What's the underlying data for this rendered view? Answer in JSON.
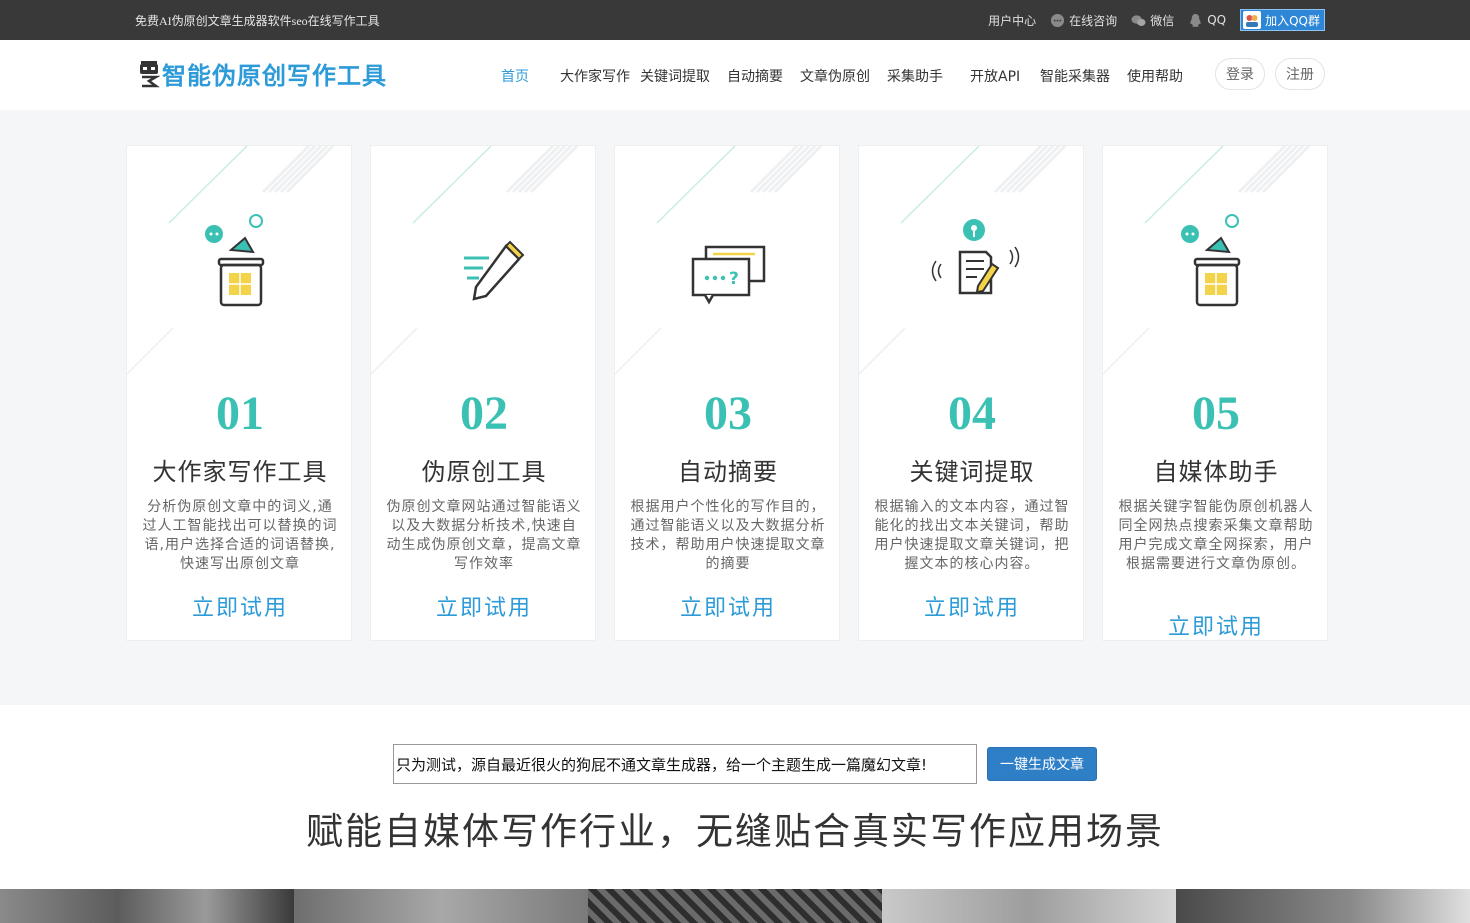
{
  "topbar": {
    "slogan": "免费AI伪原创文章生成器软件seo在线写作工具",
    "user_center": "用户中心",
    "consult": "在线咨询",
    "wechat": "微信",
    "qq": "QQ",
    "qq_group": "加入QQ群"
  },
  "header": {
    "brand": "智能伪原创写作工具",
    "nav": [
      "首页",
      "大作家写作",
      "关键词提取",
      "自动摘要",
      "文章伪原创",
      "采集助手",
      "开放API",
      "智能采集器",
      "使用帮助"
    ],
    "login": "登录",
    "register": "注册"
  },
  "features": [
    {
      "num": "01",
      "title": "大作家写作工具",
      "desc": "分析伪原创文章中的词义,通过人工智能找出可以替换的词语,用户选择合适的词语替换,快速写出原创文章",
      "cta": "立即试用",
      "icon": "jar-icon"
    },
    {
      "num": "02",
      "title": "伪原创工具",
      "desc": "伪原创文章网站通过智能语义以及大数据分析技术,快速自动生成伪原创文章，提高文章写作效率",
      "cta": "立即试用",
      "icon": "pencil-icon"
    },
    {
      "num": "03",
      "title": "自动摘要",
      "desc": "根据用户个性化的写作目的，通过智能语义以及大数据分析技术，帮助用户快速提取文章的摘要",
      "cta": "立即试用",
      "icon": "chat-bubble-icon"
    },
    {
      "num": "04",
      "title": "关键词提取",
      "desc": "根据输入的文本内容，通过智能化的找出文本关键词，帮助用户快速提取文章关键词，把握文本的核心内容。",
      "cta": "立即试用",
      "icon": "document-pen-icon"
    },
    {
      "num": "05",
      "title": "自媒体助手",
      "desc": "根据关键字智能伪原创机器人同全网热点搜索采集文章帮助用户完成文章全网探索，用户根据需要进行文章伪原创。",
      "cta": "立即试用",
      "icon": "jar-icon"
    }
  ],
  "generator": {
    "input_value": "只为测试，源自最近很火的狗屁不通文章生成器，给一个主题生成一篇魔幻文章!",
    "button": "一键生成文章",
    "headline": "赋能自媒体写作行业，无缝贴合真实写作应用场景"
  },
  "colors": {
    "topbar_bg": "#393939",
    "brand": "#2d9bd8",
    "number": "#3bc1b3",
    "button": "#2f7fc7"
  }
}
